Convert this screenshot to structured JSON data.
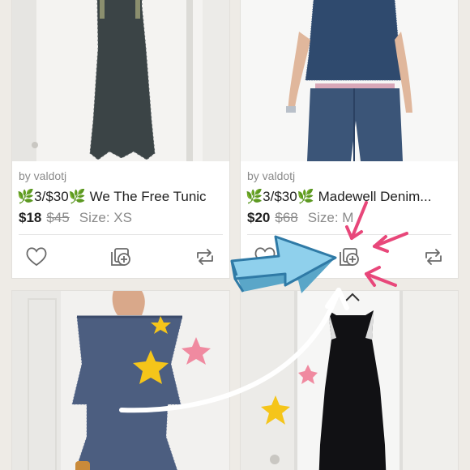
{
  "listings": [
    {
      "seller": "by valdotj",
      "emoji": "🌿",
      "bundle_deal": "3/$30",
      "title": "We The Free Tunic",
      "price": "$18",
      "original_price": "$45",
      "size_label": "Size: XS"
    },
    {
      "seller": "by valdotj",
      "emoji": "🌿",
      "bundle_deal": "3/$30",
      "title": "Madewell Denim...",
      "price": "$20",
      "original_price": "$68",
      "size_label": "Size: M"
    },
    {},
    {}
  ],
  "icons": {
    "like": "heart-icon",
    "bundle": "add-to-bundle-icon",
    "share": "share-icon"
  },
  "colors": {
    "leaf": "#4a9a3a",
    "annotation_arrow": "#8fd0ec",
    "annotation_pink": "#e8477a",
    "star_yellow": "#f5c51a",
    "star_pink": "#f08aa0"
  }
}
